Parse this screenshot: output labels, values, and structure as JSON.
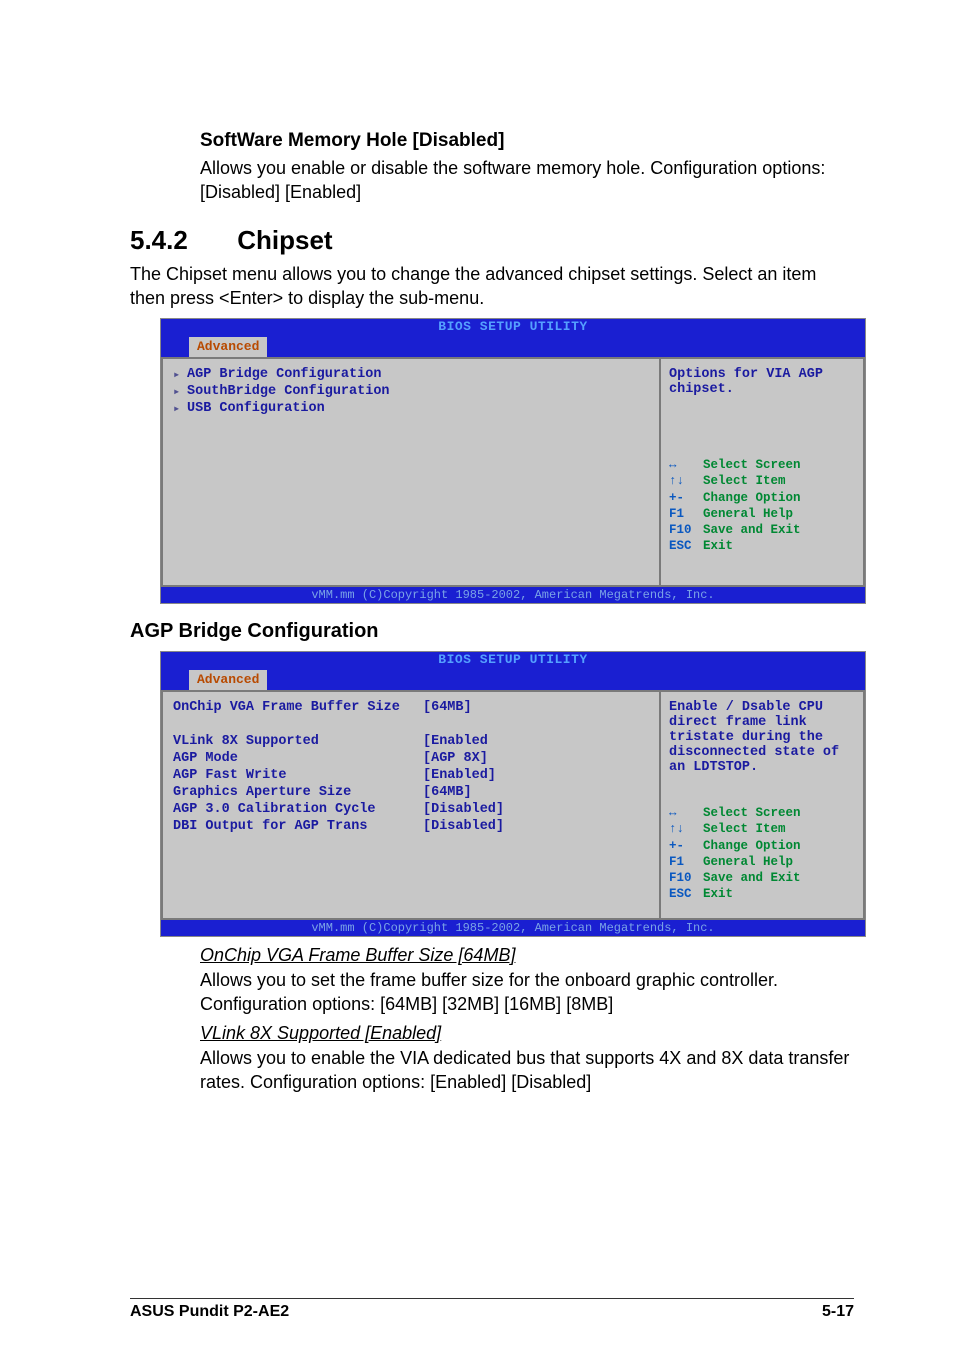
{
  "s1": {
    "title": "SoftWare Memory Hole [Disabled]",
    "p1": "Allows you enable or disable the software memory hole. Configuration options: [Disabled] [Enabled]"
  },
  "h2": {
    "num": "5.4.2",
    "title": "Chipset"
  },
  "chipset_intro": "The Chipset menu allows you to change the advanced chipset settings. Select an item then press <Enter> to display the sub-menu.",
  "bios1": {
    "title": "BIOS SETUP UTILITY",
    "tab": "Advanced",
    "items": [
      "AGP Bridge Configuration",
      "SouthBridge Configuration",
      "USB Configuration"
    ],
    "help": "Options for VIA AGP chipset.",
    "keys": [
      {
        "k": "↔",
        "t": "Select Screen"
      },
      {
        "k": "↑↓",
        "t": "Select Item"
      },
      {
        "k": "+-",
        "t": "Change Option"
      },
      {
        "k": "F1",
        "t": "General Help"
      },
      {
        "k": "F10",
        "t": "Save and Exit"
      },
      {
        "k": "ESC",
        "t": "Exit"
      }
    ],
    "footer": "vMM.mm (C)Copyright 1985-2002, American Megatrends, Inc."
  },
  "agp_heading": "AGP Bridge Configuration",
  "bios2": {
    "title": "BIOS SETUP UTILITY",
    "tab": "Advanced",
    "settings": [
      {
        "label": "OnChip VGA Frame Buffer Size",
        "value": "[64MB]"
      },
      {
        "label": "",
        "value": ""
      },
      {
        "label": "VLink 8X Supported",
        "value": "[Enabled"
      },
      {
        "label": "AGP Mode",
        "value": "[AGP 8X]"
      },
      {
        "label": "AGP Fast Write",
        "value": "[Enabled]"
      },
      {
        "label": "Graphics Aperture Size",
        "value": "[64MB]"
      },
      {
        "label": "AGP 3.0 Calibration Cycle",
        "value": "[Disabled]"
      },
      {
        "label": "DBI Output for AGP Trans",
        "value": "[Disabled]"
      }
    ],
    "help": "Enable / Dsable CPU direct frame link tristate during the disconnected state of an LDTSTOP.",
    "keys": [
      {
        "k": "↔",
        "t": "Select Screen"
      },
      {
        "k": "↑↓",
        "t": "Select Item"
      },
      {
        "k": "+-",
        "t": "Change Option"
      },
      {
        "k": "F1",
        "t": "General Help"
      },
      {
        "k": "F10",
        "t": "Save and Exit"
      },
      {
        "k": "ESC",
        "t": "Exit"
      }
    ],
    "footer": "vMM.mm (C)Copyright 1985-2002, American Megatrends, Inc."
  },
  "onchip": {
    "title": "OnChip VGA Frame Buffer Size [64MB]",
    "body": "Allows you to set the frame buffer size for the onboard graphic controller. Configuration options: [64MB] [32MB] [16MB] [8MB]"
  },
  "vlink": {
    "title": "VLink 8X Supported [Enabled]",
    "body": "Allows you to enable the VIA dedicated bus that supports 4X and 8X data transfer rates. Configuration options: [Enabled] [Disabled]"
  },
  "footer": {
    "left": "ASUS Pundit P2-AE2",
    "right": "5-17"
  }
}
